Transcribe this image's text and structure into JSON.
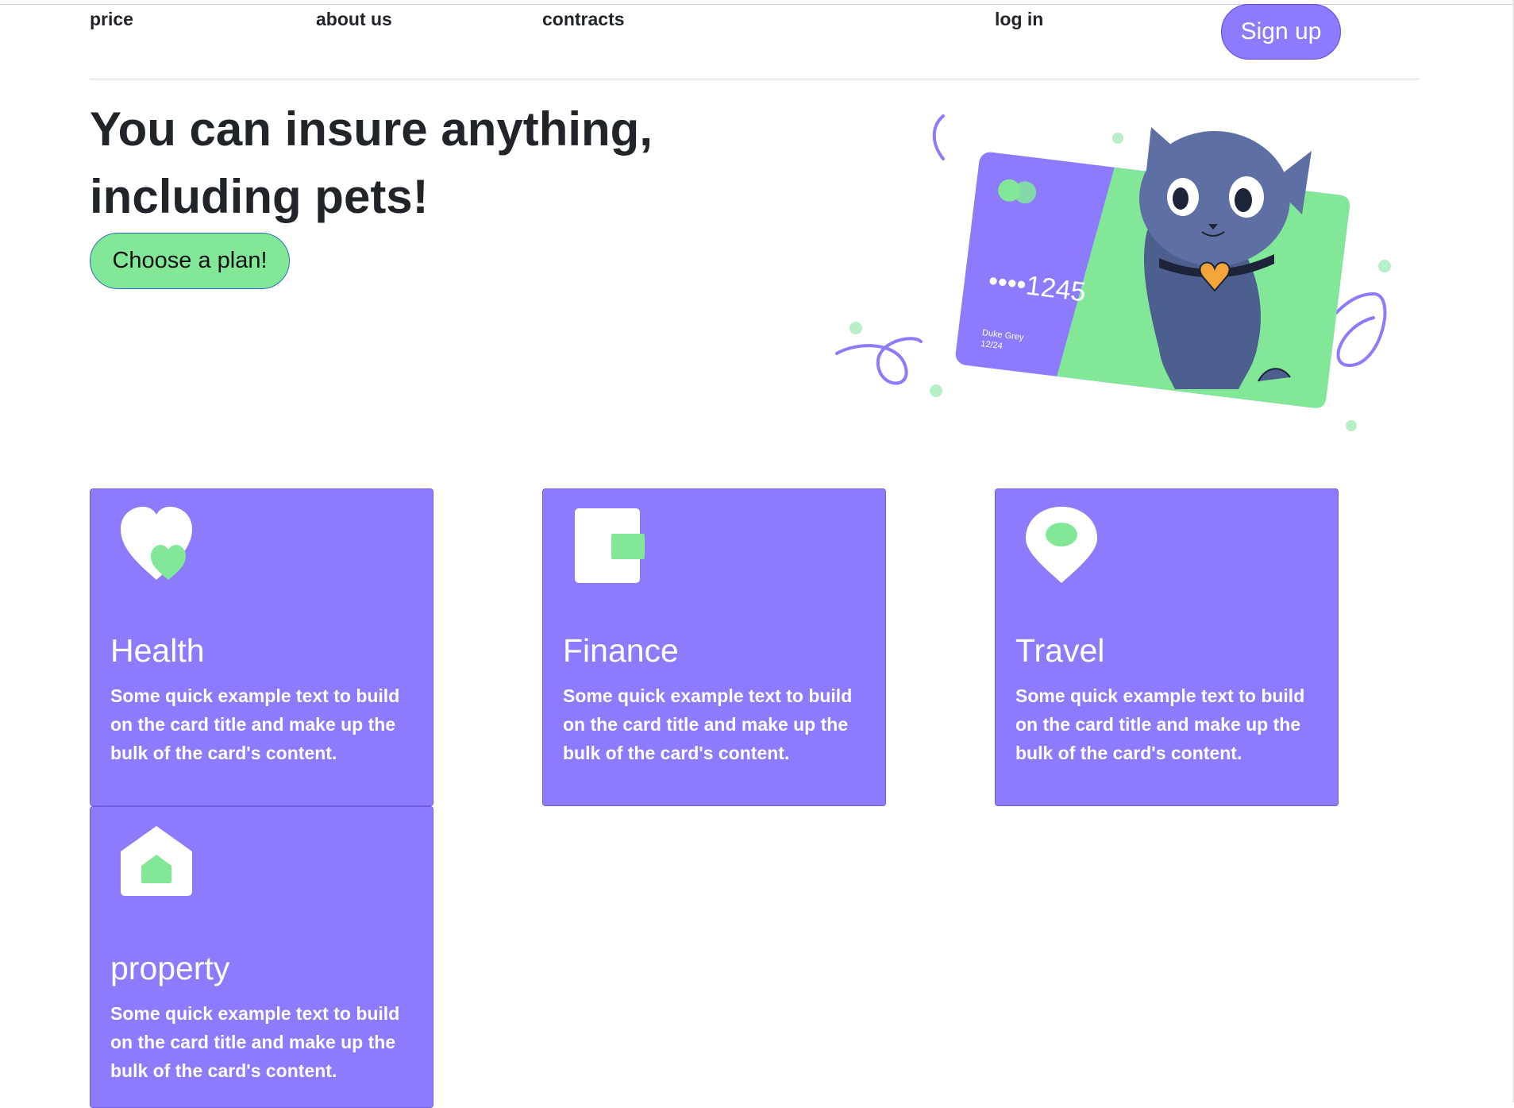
{
  "nav": {
    "links": [
      "price",
      "about us",
      "contracts",
      "log in"
    ],
    "signup_label": "Sign up"
  },
  "hero": {
    "title": "You can insure anything, including pets!",
    "cta_label": "Choose a plan!",
    "illustration": {
      "card_number": "••••1245",
      "card_holder": "Duke Grey",
      "card_expiry": "12/24"
    }
  },
  "cards": [
    {
      "title": "Health",
      "icon": "heart-icon",
      "text": "Some quick example text to build on the card title and make up the bulk of the card's content."
    },
    {
      "title": "Finance",
      "icon": "wallet-icon",
      "text": "Some quick example text to build on the card title and make up the bulk of the card's content."
    },
    {
      "title": "Travel",
      "icon": "map-pin-icon",
      "text": "Some quick example text to build on the card title and make up the bulk of the card's content."
    },
    {
      "title": "property",
      "icon": "house-icon",
      "text": "Some quick example text to build on the card title and make up the bulk of the card's content."
    }
  ],
  "colors": {
    "accent_purple": "#8c7bfc",
    "accent_green": "#82e898",
    "text_dark": "#212529"
  }
}
